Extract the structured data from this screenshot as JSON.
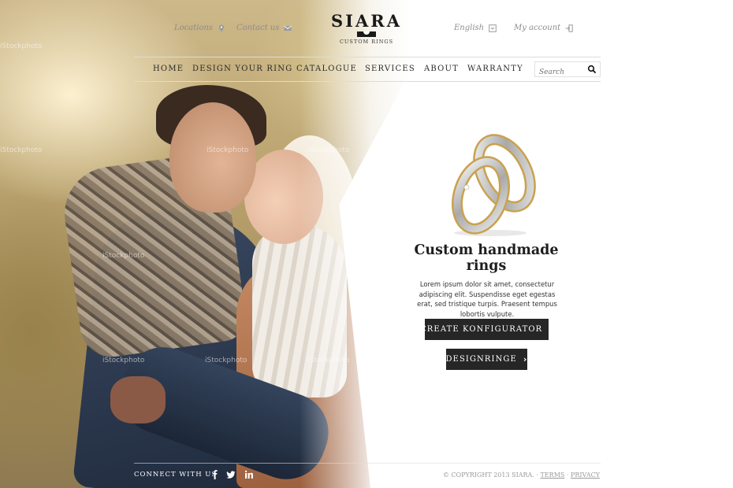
{
  "header": {
    "locations_label": "Locations",
    "contact_label": "Contact us",
    "language_label": "English",
    "account_label": "My account"
  },
  "logo": {
    "name": "SIARA",
    "tagline": "CUSTOM RINGS"
  },
  "nav": {
    "items": [
      {
        "label": "HOME"
      },
      {
        "label": "DESIGN YOUR RING"
      },
      {
        "label": "CATALOGUE"
      },
      {
        "label": "SERVICES"
      },
      {
        "label": "ABOUT"
      },
      {
        "label": "WARRANTY"
      }
    ],
    "search_placeholder": "Search"
  },
  "hero": {
    "watermark": "iStockphoto"
  },
  "promo": {
    "title": "Custom handmade rings",
    "text": "Lorem ipsum dolor sit amet, consectetur adipiscing elit. Suspendisse eget egestas erat, sed tristique turpis. Praesent tempus lobortis vulpute.",
    "primary_button": "CREATE KONFIGURATOR",
    "secondary_button": "DESIGNRINGE"
  },
  "footer": {
    "connect_label": "CONNECT WITH US",
    "social_icons": [
      "facebook-icon",
      "twitter-icon",
      "linkedin-icon"
    ],
    "copyright": "© COPYRIGHT 2013 SIARA.",
    "terms_label": "TERMS",
    "privacy_label": "PRIVACY",
    "separator": "·"
  },
  "colors": {
    "button_bg": "#262626",
    "text_dark": "#1e1e1e",
    "muted": "#8d8d8d",
    "gold": "#c9a24e"
  }
}
